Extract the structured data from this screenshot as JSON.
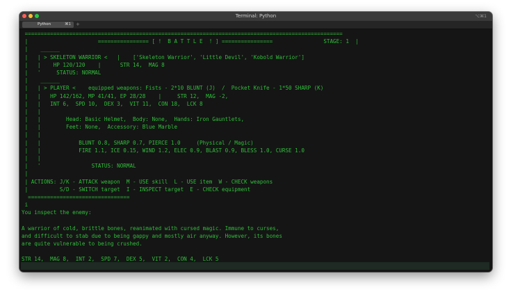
{
  "window": {
    "title": "Terminal: Python",
    "shortcut": "⌥⌘1"
  },
  "tab": {
    "label": "Python",
    "shortcut": "⌘1",
    "add": "+"
  },
  "colors": {
    "terminal_text": "#2fbf3a",
    "terminal_bg": "#151515"
  },
  "terminal": {
    "lines": [
      " ====================================================================================================",
      " |                      ================ [ !  B A T T L E  ! ] ================                STAGE: 1  |",
      " |    ______",
      " |   | > SKELETON WARRIOR <   |    ['Skeleton Warrior', 'Little Devil', 'Kobold Warrior']",
      " |   |    HP 120/120    |      STR 14,  MAG 8",
      " |   '     STATUS: NORMAL",
      " |    ______",
      " |   | > PLAYER <    equipped weapons: Fists - 2*10 BLUNT (J)  /  Pocket Knife - 1*50 SHARP (K)",
      " |   |   HP 142/162, MP 41/41, EP 28/28    |     STR 12,  MAG -2,",
      " |   |   INT 6,  SPD 10,  DEX 3,  VIT 11,  CON 18,  LCK 8",
      " |   |",
      " |   |        Head: Basic Helmet,  Body: None,  Hands: Iron Gauntlets,",
      " |   |        Feet: None,  Accessory: Blue Marble",
      " |   |",
      " |   |            BLUNT 0.8, SHARP 0.7, PIERCE 1.0     (Physical / Magic)",
      " |   |            FIRE 1.1, ICE 0.15, WIND 1.2, ELEC 0.9, BLAST 0.9, BLESS 1.0, CURSE 1.0",
      " |   |",
      " |   '                STATUS: NORMAL",
      " |",
      " | ACTIONS: J/K - ATTACK weapon  M - USE skill  L - USE item  W - CHECK weapons",
      " |          S/D - SWITCH target  I - INSPECT target  E - CHECK equipment",
      "  ================================",
      " i",
      "You inspect the enemy:",
      "",
      "A warrior of cold, brittle bones, reanimated with cursed magic. Immune to curses,",
      "and difficult to stab due to being gappy and mostly air anyway. However, its bones",
      "are quite vulnerable to being crushed.",
      "",
      "STR 14,  MAG 8,  INT 2,  SPD 7,  DEX 5,  VIT 2,  CON 4,  LCK 5",
      "/"
    ]
  }
}
